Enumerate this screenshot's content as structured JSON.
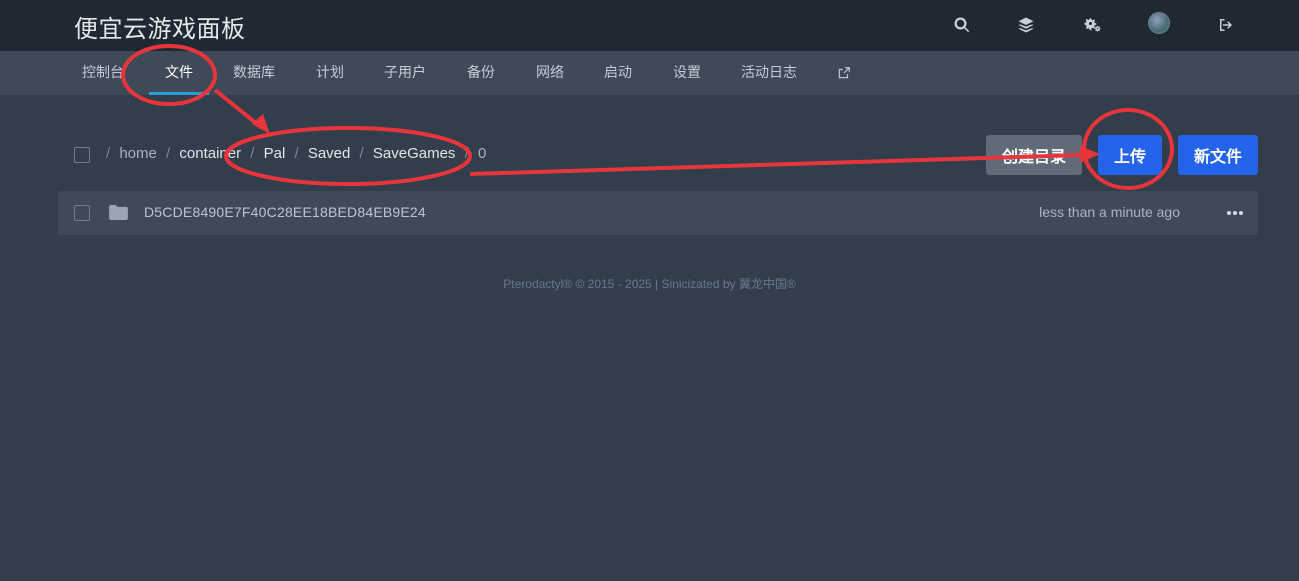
{
  "app": {
    "title": "便宜云游戏面板"
  },
  "topbar": {
    "icons": [
      "search-icon",
      "layers-icon",
      "settings-icon",
      "avatar",
      "logout-icon"
    ]
  },
  "nav": {
    "items": [
      {
        "label": "控制台"
      },
      {
        "label": "文件"
      },
      {
        "label": "数据库"
      },
      {
        "label": "计划"
      },
      {
        "label": "子用户"
      },
      {
        "label": "备份"
      },
      {
        "label": "网络"
      },
      {
        "label": "启动"
      },
      {
        "label": "设置"
      },
      {
        "label": "活动日志"
      }
    ],
    "active": "文件",
    "external_icon": "external-link-icon"
  },
  "breadcrumb": {
    "segments": [
      "home",
      "container",
      "Pal",
      "Saved",
      "SaveGames",
      "0"
    ],
    "separator": "/"
  },
  "buttons": {
    "create_dir": "创建目录",
    "upload": "上传",
    "new_file": "新文件"
  },
  "files": [
    {
      "name": "D5CDE8490E7F40C28EE18BED84EB9E24",
      "modified": "less than a minute ago",
      "type": "folder"
    }
  ],
  "footer": {
    "text": "Pterodactyl® © 2015 - 2025 | Sinicizated by 翼龙中国®"
  },
  "colors": {
    "accent_blue": "#2563eb",
    "annotation_red": "#e8353b",
    "nav_active_underline": "#2b9fd4"
  }
}
